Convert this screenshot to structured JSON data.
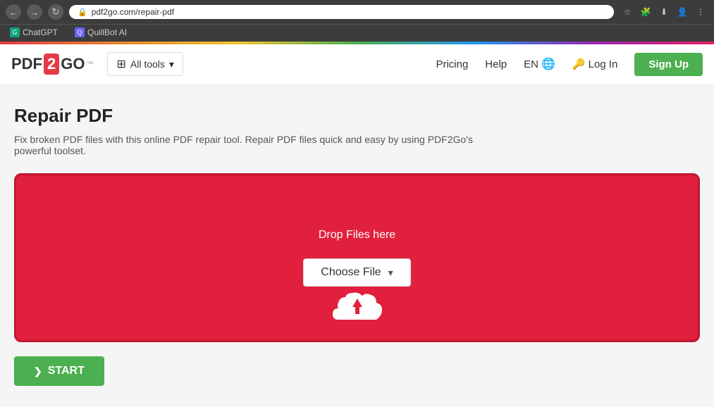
{
  "browser": {
    "url": "pdf2go.com/repair-pdf",
    "back_btn": "←",
    "forward_btn": "→",
    "reload_btn": "↻",
    "bookmarks": [
      {
        "label": "ChatGPT",
        "color": "#10a37f"
      },
      {
        "label": "QuillBot AI",
        "color": "#6c63ff"
      }
    ]
  },
  "rainbow": true,
  "nav": {
    "logo_pdf": "PDF",
    "logo_2": "2",
    "logo_go": "GO",
    "logo_tm": "™",
    "all_tools_label": "All tools",
    "pricing_label": "Pricing",
    "help_label": "Help",
    "lang_label": "EN",
    "login_label": "Log In",
    "signup_label": "Sign Up"
  },
  "page": {
    "title": "Repair PDF",
    "description": "Fix broken PDF files with this online PDF repair tool. Repair PDF files quick and easy by using PDF2Go's powerful toolset."
  },
  "upload": {
    "drop_text": "Drop Files here",
    "choose_file_label": "Choose File"
  },
  "start": {
    "label": "START",
    "icon": "❯"
  }
}
